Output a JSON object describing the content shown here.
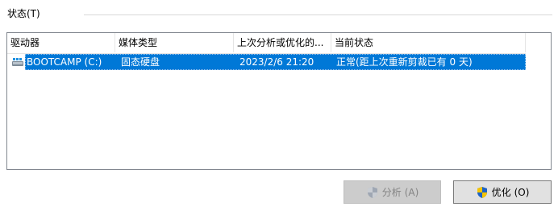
{
  "status_group": {
    "label": "状态(T)"
  },
  "list": {
    "columns": [
      "驱动器",
      "媒体类型",
      "上次分析或优化的...",
      "当前状态"
    ],
    "rows": [
      {
        "drive": "BOOTCAMP (C:)",
        "media": "固态硬盘",
        "last": "2023/2/6 21:20",
        "status": "正常(距上次重新剪裁已有 0 天)"
      }
    ]
  },
  "buttons": {
    "analyze": {
      "label": "分析",
      "mnemonic": "(A)"
    },
    "optimize": {
      "label": "优化",
      "mnemonic": "(O)"
    }
  },
  "icons": {
    "drive": "drive-icon",
    "shield": "uac-shield-icon"
  },
  "colors": {
    "selection": "#0078d7",
    "accent": "#0078d7"
  }
}
